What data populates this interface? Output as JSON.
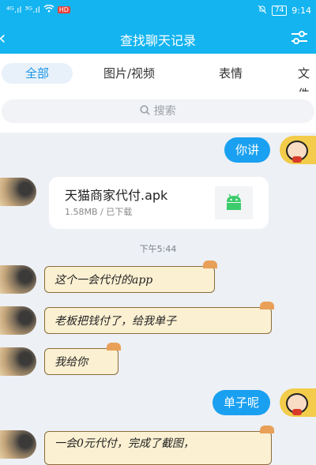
{
  "status_bar": {
    "signal1": "⁴ᴳ.ıl",
    "signal2": "³ᴳ.ıl",
    "wifi": "wifi",
    "hd_badge": "HD",
    "battery": "74",
    "time": "9:14"
  },
  "header": {
    "title": "查找聊天记录"
  },
  "tabs": [
    "全部",
    "图片/视频",
    "表情",
    "文件"
  ],
  "search": {
    "placeholder": "搜索"
  },
  "messages": {
    "m1": "你讲",
    "file_name": "天猫商家代付.apk",
    "file_meta": "1.58MB / 已下载",
    "time": "下午5:44",
    "m2": "这个一会代付的app",
    "m3": "老板把钱付了，给我单子",
    "m4": "我给你",
    "m5": "单子呢",
    "m6": "一会0元代付，完成了截图，"
  }
}
